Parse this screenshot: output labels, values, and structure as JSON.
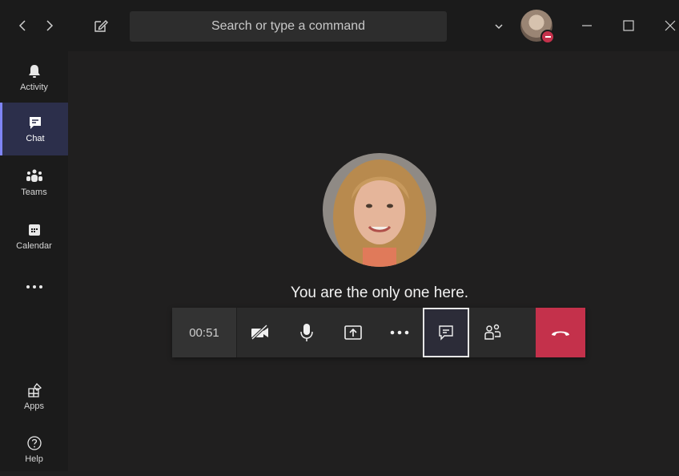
{
  "titlebar": {
    "search_placeholder": "Search or type a command",
    "back_icon": "chevron-left-icon",
    "forward_icon": "chevron-right-icon",
    "compose_icon": "compose-icon",
    "account_menu_icon": "chevron-down-icon",
    "presence_status": "do-not-disturb",
    "window_controls": [
      "minimize-icon",
      "maximize-icon",
      "close-icon"
    ]
  },
  "rail": {
    "items": [
      {
        "label": "Activity",
        "icon": "bell-icon"
      },
      {
        "label": "Chat",
        "icon": "chat-icon",
        "active": true
      },
      {
        "label": "Teams",
        "icon": "teams-icon"
      },
      {
        "label": "Calendar",
        "icon": "calendar-icon"
      }
    ],
    "more_icon": "more-horizontal-icon",
    "bottom_items": [
      {
        "label": "Apps",
        "icon": "apps-icon"
      },
      {
        "label": "Help",
        "icon": "help-icon"
      }
    ]
  },
  "call": {
    "status_text": "You are the only one here.",
    "timer": "00:51",
    "controls": [
      {
        "name": "camera-toggle",
        "icon": "camera-off-icon"
      },
      {
        "name": "mic-toggle",
        "icon": "microphone-icon"
      },
      {
        "name": "share-screen",
        "icon": "share-screen-icon"
      },
      {
        "name": "more-actions",
        "icon": "more-horizontal-icon"
      },
      {
        "name": "show-conversation",
        "icon": "chat-bubble-icon",
        "active": true
      },
      {
        "name": "show-participants",
        "icon": "participants-icon"
      },
      {
        "name": "hang-up",
        "icon": "phone-hangup-icon"
      }
    ]
  },
  "colors": {
    "background": "#201f1f",
    "rail_background": "#1b1b1b",
    "active_accent": "#7f85f5",
    "hangup_red": "#c4314b",
    "presence_red": "#c4314b"
  }
}
